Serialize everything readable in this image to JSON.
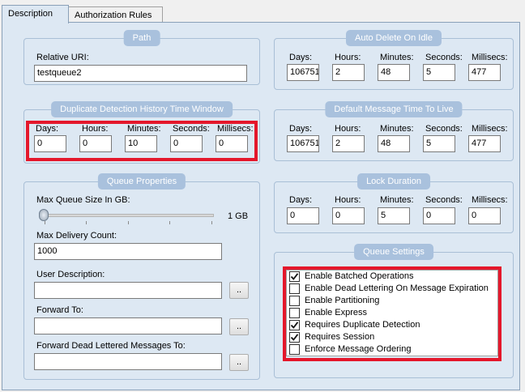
{
  "tabs": [
    {
      "label": "Description"
    },
    {
      "label": "Authorization Rules"
    }
  ],
  "path": {
    "title": "Path",
    "relative_uri_label": "Relative URI:",
    "relative_uri_value": "testqueue2"
  },
  "dup_detection": {
    "title": "Duplicate Detection History Time Window",
    "labels": {
      "days": "Days:",
      "hours": "Hours:",
      "minutes": "Minutes:",
      "seconds": "Seconds:",
      "millisecs": "Millisecs:"
    },
    "values": {
      "days": "0",
      "hours": "0",
      "minutes": "10",
      "seconds": "0",
      "millisecs": "0"
    }
  },
  "queue_properties": {
    "title": "Queue Properties",
    "max_size_label": "Max Queue Size In GB:",
    "max_size_value_label": "1 GB",
    "max_size_slider_fraction": 0,
    "max_delivery_label": "Max Delivery Count:",
    "max_delivery_value": "1000",
    "user_description_label": "User Description:",
    "user_description_value": "",
    "forward_to_label": "Forward To:",
    "forward_to_value": "",
    "forward_dead_label": "Forward Dead Lettered Messages To:",
    "forward_dead_value": "",
    "browse_label": ".."
  },
  "auto_delete": {
    "title": "Auto Delete On Idle",
    "labels": {
      "days": "Days:",
      "hours": "Hours:",
      "minutes": "Minutes:",
      "seconds": "Seconds:",
      "millisecs": "Millisecs:"
    },
    "values": {
      "days": "106751",
      "hours": "2",
      "minutes": "48",
      "seconds": "5",
      "millisecs": "477"
    }
  },
  "default_ttl": {
    "title": "Default Message Time To Live",
    "labels": {
      "days": "Days:",
      "hours": "Hours:",
      "minutes": "Minutes:",
      "seconds": "Seconds:",
      "millisecs": "Millisecs:"
    },
    "values": {
      "days": "106751",
      "hours": "2",
      "minutes": "48",
      "seconds": "5",
      "millisecs": "477"
    }
  },
  "lock_duration": {
    "title": "Lock Duration",
    "labels": {
      "days": "Days:",
      "hours": "Hours:",
      "minutes": "Minutes:",
      "seconds": "Seconds:",
      "millisecs": "Millisecs:"
    },
    "values": {
      "days": "0",
      "hours": "0",
      "minutes": "5",
      "seconds": "0",
      "millisecs": "0"
    }
  },
  "queue_settings": {
    "title": "Queue Settings",
    "items": [
      {
        "label": "Enable Batched Operations",
        "checked": true
      },
      {
        "label": "Enable Dead Lettering On Message Expiration",
        "checked": false
      },
      {
        "label": "Enable Partitioning",
        "checked": false
      },
      {
        "label": "Enable Express",
        "checked": false
      },
      {
        "label": "Requires Duplicate Detection",
        "checked": true
      },
      {
        "label": "Requires Session",
        "checked": true
      },
      {
        "label": "Enforce Message Ordering",
        "checked": false
      }
    ]
  },
  "colors": {
    "panel_bg": "#dde8f3",
    "group_title_bg": "#a9c1dd",
    "highlight_red": "#e4172b"
  }
}
